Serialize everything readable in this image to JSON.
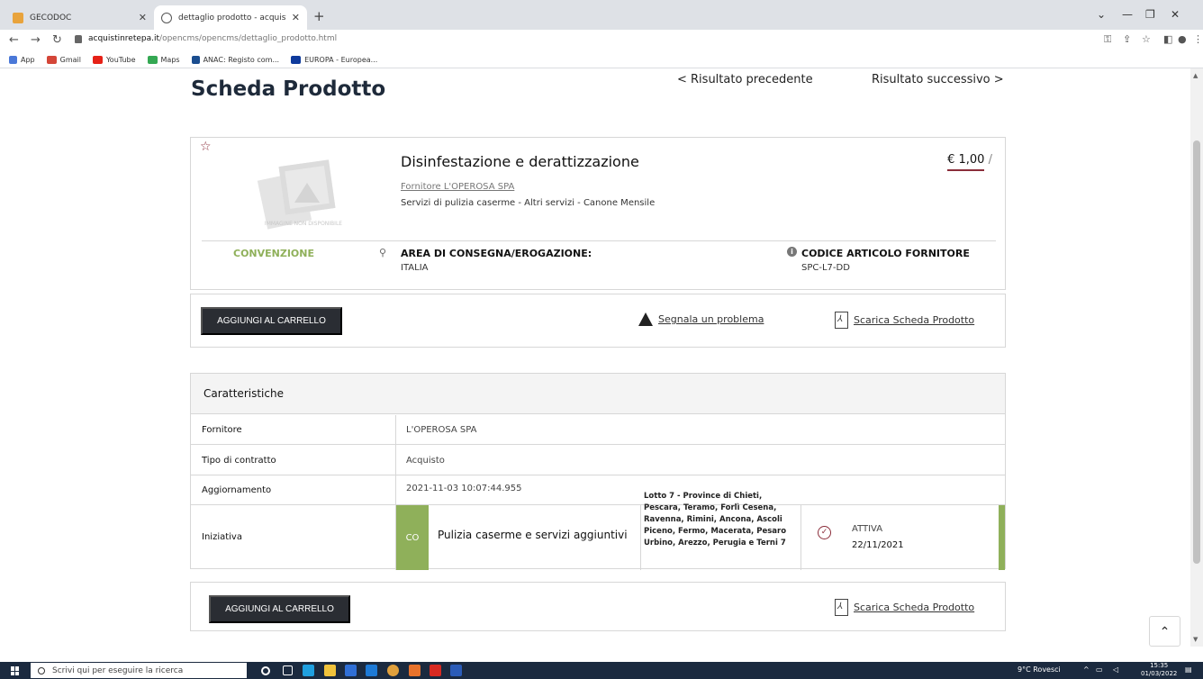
{
  "browser": {
    "tabs": [
      {
        "title": "GECODOC",
        "active": false
      },
      {
        "title": "dettaglio prodotto - acquistinreti",
        "active": true
      }
    ],
    "new_tab": "+",
    "url_host": "acquistinretepa.it",
    "url_path": "/opencms/opencms/dettaglio_prodotto.html",
    "bookmarks": [
      "App",
      "Gmail",
      "YouTube",
      "Maps",
      "ANAC: Registo com...",
      "EUROPA - Europea..."
    ],
    "colors": {
      "accent": "#8b2d3a",
      "green": "#8fb05a",
      "dark_button": "#2a2d33"
    }
  },
  "page": {
    "title": "Scheda Prodotto",
    "prev": "< Risultato precedente",
    "next": "Risultato successivo >"
  },
  "product": {
    "image_caption": "IMMAGINE NON DISPONIBILE",
    "name": "Disinfestazione e derattizzazione",
    "supplier_link": "Fornitore L'OPEROSA SPA",
    "category": "Servizi di pulizia caserme - Altri servizi - Canone Mensile",
    "price": "€ 1,00",
    "price_suffix": "/",
    "type": "CONVENZIONE",
    "area_label": "AREA DI CONSEGNA/EROGAZIONE:",
    "area_value": "ITALIA",
    "code_label": "CODICE ARTICOLO FORNITORE",
    "code_value": "SPC-L7-DD"
  },
  "actions": {
    "add_to_cart": "AGGIUNGI AL CARRELLO",
    "report_problem": "Segnala un problema",
    "download": "Scarica Scheda Prodotto"
  },
  "characteristics": {
    "heading": "Caratteristiche",
    "rows": [
      {
        "key": "Fornitore",
        "value": "L'OPEROSA SPA"
      },
      {
        "key": "Tipo di contratto",
        "value": "Acquisto"
      },
      {
        "key": "Aggiornamento",
        "value": "2021-11-03 10:07:44.955"
      }
    ],
    "initiative": {
      "key": "Iniziativa",
      "badge": "CO",
      "title": "Pulizia caserme e servizi aggiuntivi",
      "lotto": "Lotto 7 - Province di Chieti, Pescara, Teramo, Forlì Cesena, Ravenna, Rimini, Ancona, Ascoli Piceno, Fermo, Macerata, Pesaro Urbino, Arezzo, Perugia e Terni 7",
      "status": "ATTIVA",
      "status_date": "22/11/2021"
    }
  },
  "taskbar": {
    "search_placeholder": "Scrivi qui per eseguire la ricerca",
    "weather": "9°C Rovesci",
    "time": "15:35",
    "date": "01/03/2022"
  }
}
